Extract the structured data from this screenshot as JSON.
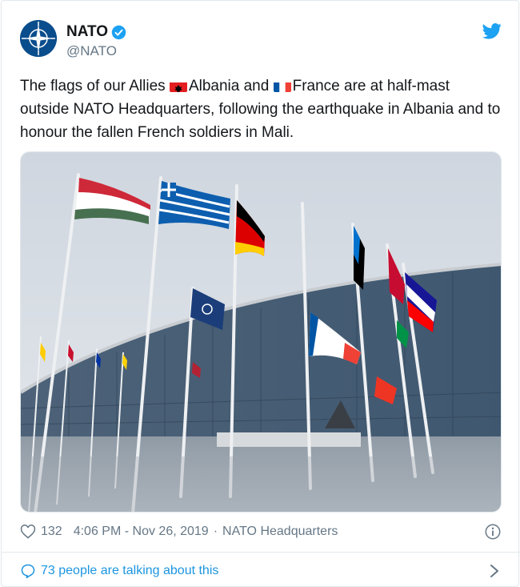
{
  "account": {
    "name": "NATO",
    "handle": "@NATO",
    "verified": true
  },
  "tweet": {
    "text_part1": "The flags of our Allies ",
    "flag1": "Albania",
    "text_part2": " ",
    "text_and": "and ",
    "flag2": "France",
    "text_part3": " are at half-mast outside NATO Headquarters, following the earthquake in Albania and to honour the fallen French soldiers in Mali."
  },
  "meta": {
    "likes": "132",
    "time": "4:06 PM",
    "date": "Nov 26, 2019",
    "separator_dash": " - ",
    "separator_dot": "·",
    "location": "NATO Headquarters"
  },
  "conversation": {
    "label": "73 people are talking about this"
  },
  "icons": {
    "avatar": "nato-compass-logo",
    "verified": "verified-badge-icon",
    "bird": "twitter-bird-icon",
    "heart": "heart-icon",
    "info": "info-icon",
    "bubble": "speech-bubble-icon",
    "chevron": "chevron-right-icon"
  },
  "colors": {
    "accent": "#1b95e0",
    "text": "#14171a",
    "muted": "#657786",
    "border": "#e1e8ed"
  }
}
